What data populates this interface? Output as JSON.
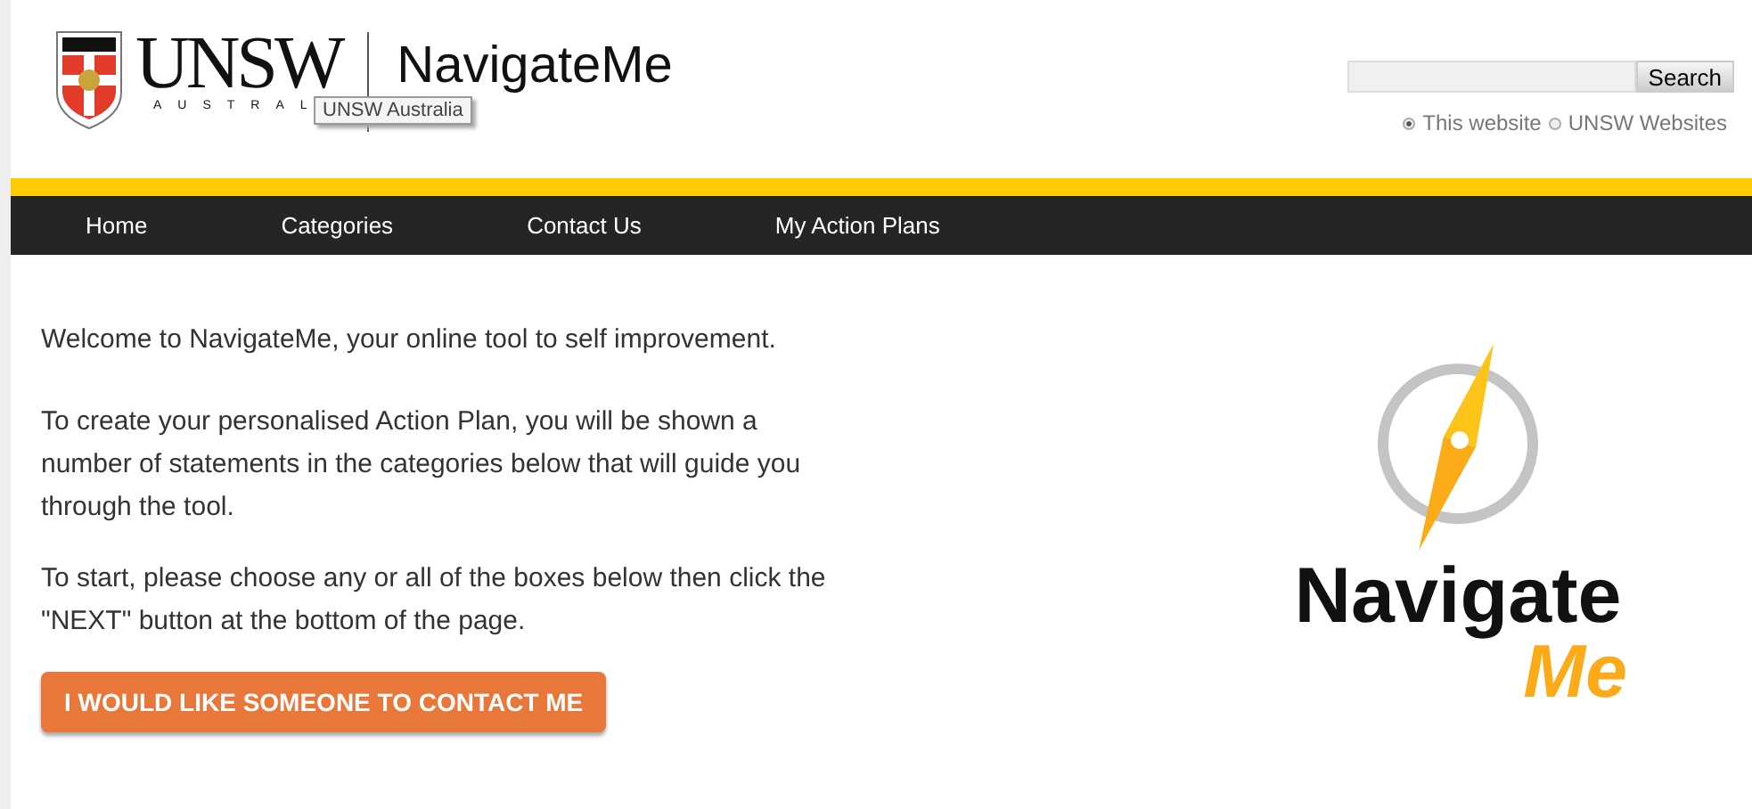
{
  "header": {
    "logo_word": "UNSW",
    "logo_subword": "AUSTRAL",
    "site_title": "NavigateMe",
    "tooltip": "UNSW Australia"
  },
  "search": {
    "button": "Search",
    "scopes": [
      {
        "label": "This website",
        "selected": true
      },
      {
        "label": "UNSW Websites",
        "selected": false
      }
    ]
  },
  "nav": [
    {
      "label": "Home"
    },
    {
      "label": "Categories"
    },
    {
      "label": "Contact Us"
    },
    {
      "label": "My Action Plans"
    }
  ],
  "content": {
    "paragraphs": [
      "Welcome to NavigateMe, your online tool to self improvement.",
      "To create your personalised Action Plan, you will be shown a number of statements in the categories below that will guide you through the tool.",
      "To start, please choose any or all of the boxes below then click the \"NEXT\" button at the bottom of the page."
    ],
    "contact_button": "I WOULD LIKE SOMEONE TO CONTACT ME"
  },
  "brand": {
    "word": "Navigate",
    "word2": "Me"
  }
}
